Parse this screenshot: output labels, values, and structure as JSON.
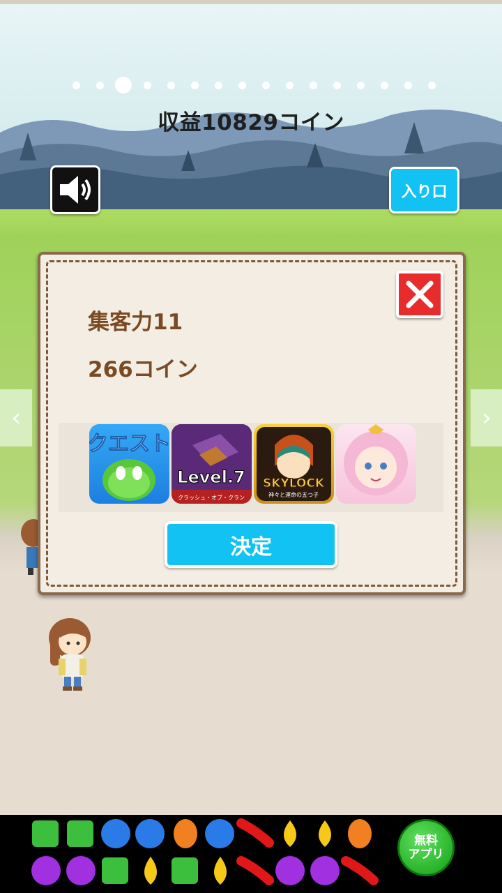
{
  "page": {
    "income_text": "収益10829コイン",
    "pager": {
      "count": 16,
      "active_index": 2
    },
    "entrance_label": "入り口",
    "sound_icon": "speaker-icon",
    "nav": {
      "prev_icon": "‹",
      "next_icon": "›"
    }
  },
  "dialog": {
    "capacity_text": "集客力11",
    "coins_text": "266コイン",
    "confirm_label": "決定",
    "close_icon": "close-icon"
  },
  "apps": [
    {
      "title": "クエスト",
      "icon": "puyo-quest-app-icon"
    },
    {
      "title": "Level.7",
      "subtitle": "クラッシュ・オブ・クラン",
      "icon": "clash-of-clans-app-icon"
    },
    {
      "title": "SKYLOCK",
      "subtitle": "神々と運命の五つ子",
      "icon": "skylock-app-icon"
    },
    {
      "title": "",
      "icon": "anime-girl-app-icon"
    }
  ],
  "ad": {
    "badge_text_line1": "無料",
    "badge_text_line2": "アプリ",
    "icon": "candy-game-ad-icon"
  },
  "colors": {
    "accent": "#12c2f2",
    "close": "#e82b2b",
    "stat_text": "#7a4a22",
    "dialog_border": "#8a6a4c"
  }
}
